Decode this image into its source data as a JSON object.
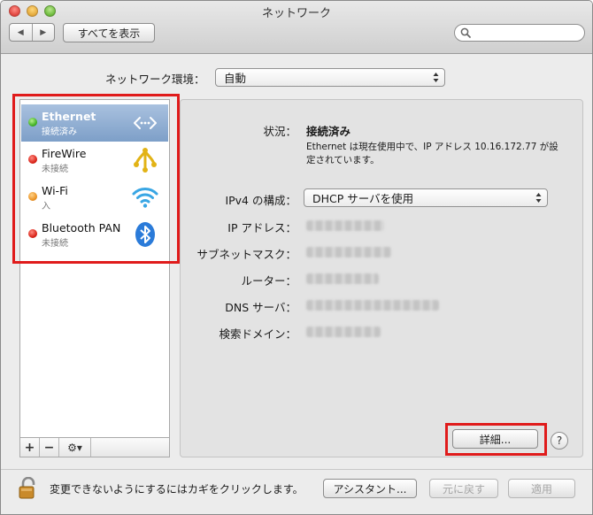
{
  "window": {
    "title": "ネットワーク"
  },
  "toolbar": {
    "back_label": "◀",
    "forward_label": "▶",
    "show_all_label": "すべてを表示",
    "search_placeholder": ""
  },
  "location": {
    "label": "ネットワーク環境：",
    "value": "自動"
  },
  "services": [
    {
      "name": "Ethernet",
      "status": "接続済み",
      "status_color": "green",
      "icon": "ethernet-icon",
      "selected": true
    },
    {
      "name": "FireWire",
      "status": "未接続",
      "status_color": "red",
      "icon": "firewire-icon",
      "selected": false
    },
    {
      "name": "Wi-Fi",
      "status": "入",
      "status_color": "orange",
      "icon": "wifi-icon",
      "selected": false
    },
    {
      "name": "Bluetooth PAN",
      "status": "未接続",
      "status_color": "red",
      "icon": "bluetooth-icon",
      "selected": false
    }
  ],
  "sidebar_buttons": {
    "add": "+",
    "remove": "−",
    "gear": "⚙▾"
  },
  "detail": {
    "status_label": "状況：",
    "status_value": "接続済み",
    "status_desc_line1": "Ethernet は現在使用中で、IP アドレス 10.16.172.77 が設",
    "status_desc_line2": "定されています。",
    "ipv4_label": "IPv4 の構成：",
    "ipv4_value": "DHCP サーバを使用",
    "ip_label": "IP アドレス：",
    "subnet_label": "サブネットマスク：",
    "router_label": "ルーター：",
    "dns_label": "DNS サーバ：",
    "search_domain_label": "検索ドメイン：",
    "advanced_label": "詳細...",
    "help_label": "?"
  },
  "footer": {
    "lock_text": "変更できないようにするにはカギをクリックします。",
    "assistant_label": "アシスタント...",
    "revert_label": "元に戻す",
    "apply_label": "適用"
  },
  "colors": {
    "highlight": "#e01b1b",
    "selection": "#7d9fc8"
  }
}
